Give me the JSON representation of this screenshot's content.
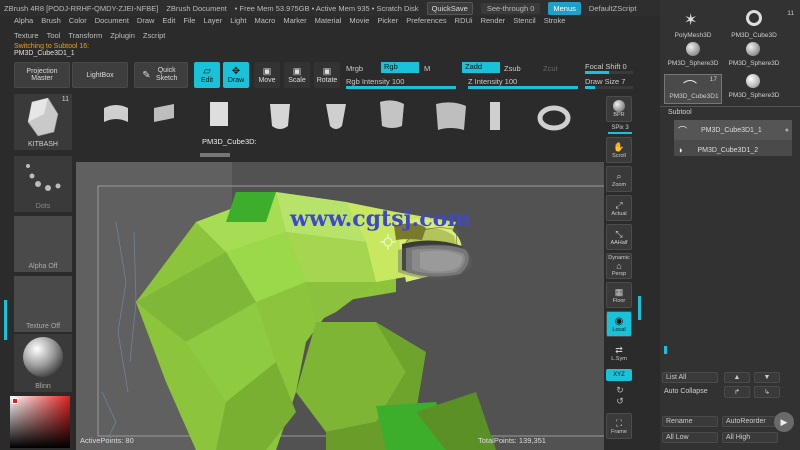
{
  "titlebar": {
    "app": "ZBrush 4R8 [PODJ-RRHF-QMDY-ZJEI-NFBE]",
    "document": "ZBrush Document",
    "free_mem": "• Free Mem 53.975GB • Active Mem 935 • Scratch Disk",
    "quicksave": "QuickSave",
    "seethrough": "See-through",
    "seethrough_value": "0",
    "menus": "Menus",
    "script": "DefaultZScript"
  },
  "menu": [
    "Alpha",
    "Brush",
    "Color",
    "Document",
    "Draw",
    "Edit",
    "File",
    "Layer",
    "Light",
    "Macro",
    "Marker",
    "Material",
    "Movie",
    "Picker",
    "Preferences",
    "RDUi",
    "Render",
    "Stencil",
    "Stroke"
  ],
  "menu2": [
    "Texture",
    "Tool",
    "Transform",
    "Zplugin",
    "Zscript"
  ],
  "status_switch": "Switching to Subtool 16:",
  "status_name": "PM3D_Cube3D1_1",
  "toolbar": {
    "projection_master": "Projection Master",
    "lightbox": "LightBox",
    "quick_sketch": "Quick Sketch",
    "edit": "Edit",
    "draw": "Draw",
    "move": "Move",
    "scale": "Scale",
    "rotate": "Rotate",
    "mrgb": "Mrgb",
    "rgb": "Rgb",
    "m": "M",
    "zadd": "Zadd",
    "zsub": "Zsub",
    "zcut": "Zcut",
    "rgb_intensity": "Rgb Intensity 100",
    "z_intensity": "Z Intensity 100",
    "focal_shift": "Focal Shift 0",
    "draw_size": "Draw Size 7"
  },
  "shelf": {
    "kitbash_count": "11",
    "kitbash_label": "KITBASH",
    "selected_label": "PM3D_Cube3D:"
  },
  "left": {
    "dots": "Dots",
    "alpha": "Alpha Off",
    "texture": "Texture Off",
    "material": "Blinn"
  },
  "canvas": {
    "watermark": "www.cgtsj.com",
    "active_points": "ActivePoints: 80",
    "total_points": "TotalPoints: 139,351"
  },
  "righttools": {
    "bpr": "BPR",
    "spix": "SPix 3",
    "scroll": "Scroll",
    "zoom": "Zoom",
    "actual": "Actual",
    "aahalf": "AAHalf",
    "dynamic": "Dynamic",
    "persp": "Persp",
    "floor": "Floor",
    "local": "Local",
    "lsym": "L.Sym",
    "xyz": "XYZ",
    "frame": "Frame"
  },
  "rpanel": {
    "thumbs": [
      {
        "label": "PolyMesh3D"
      },
      {
        "label": "PM3D_Cube3D",
        "count": "11"
      },
      {
        "label": "PM3D_Sphere3D"
      },
      {
        "label": "PM3D_Sphere3D"
      },
      {
        "label": "PM3D_Cube3D1",
        "count": "17"
      },
      {
        "label": "PM3D_Sphere3D"
      }
    ],
    "subtool_title": "Subtool",
    "subtools": [
      "PM3D_Cube3D1_1",
      "PM3D_Cube3D1_2"
    ],
    "list_all": "List All",
    "auto_collapse": "Auto Collapse",
    "rename": "Rename",
    "autoreorder": "AutoReorder",
    "all_low": "All Low",
    "all_high": "All High"
  },
  "colors": {
    "accent": "#19c2d8",
    "model_green": "#9bd84a",
    "warning": "#e8a020"
  }
}
